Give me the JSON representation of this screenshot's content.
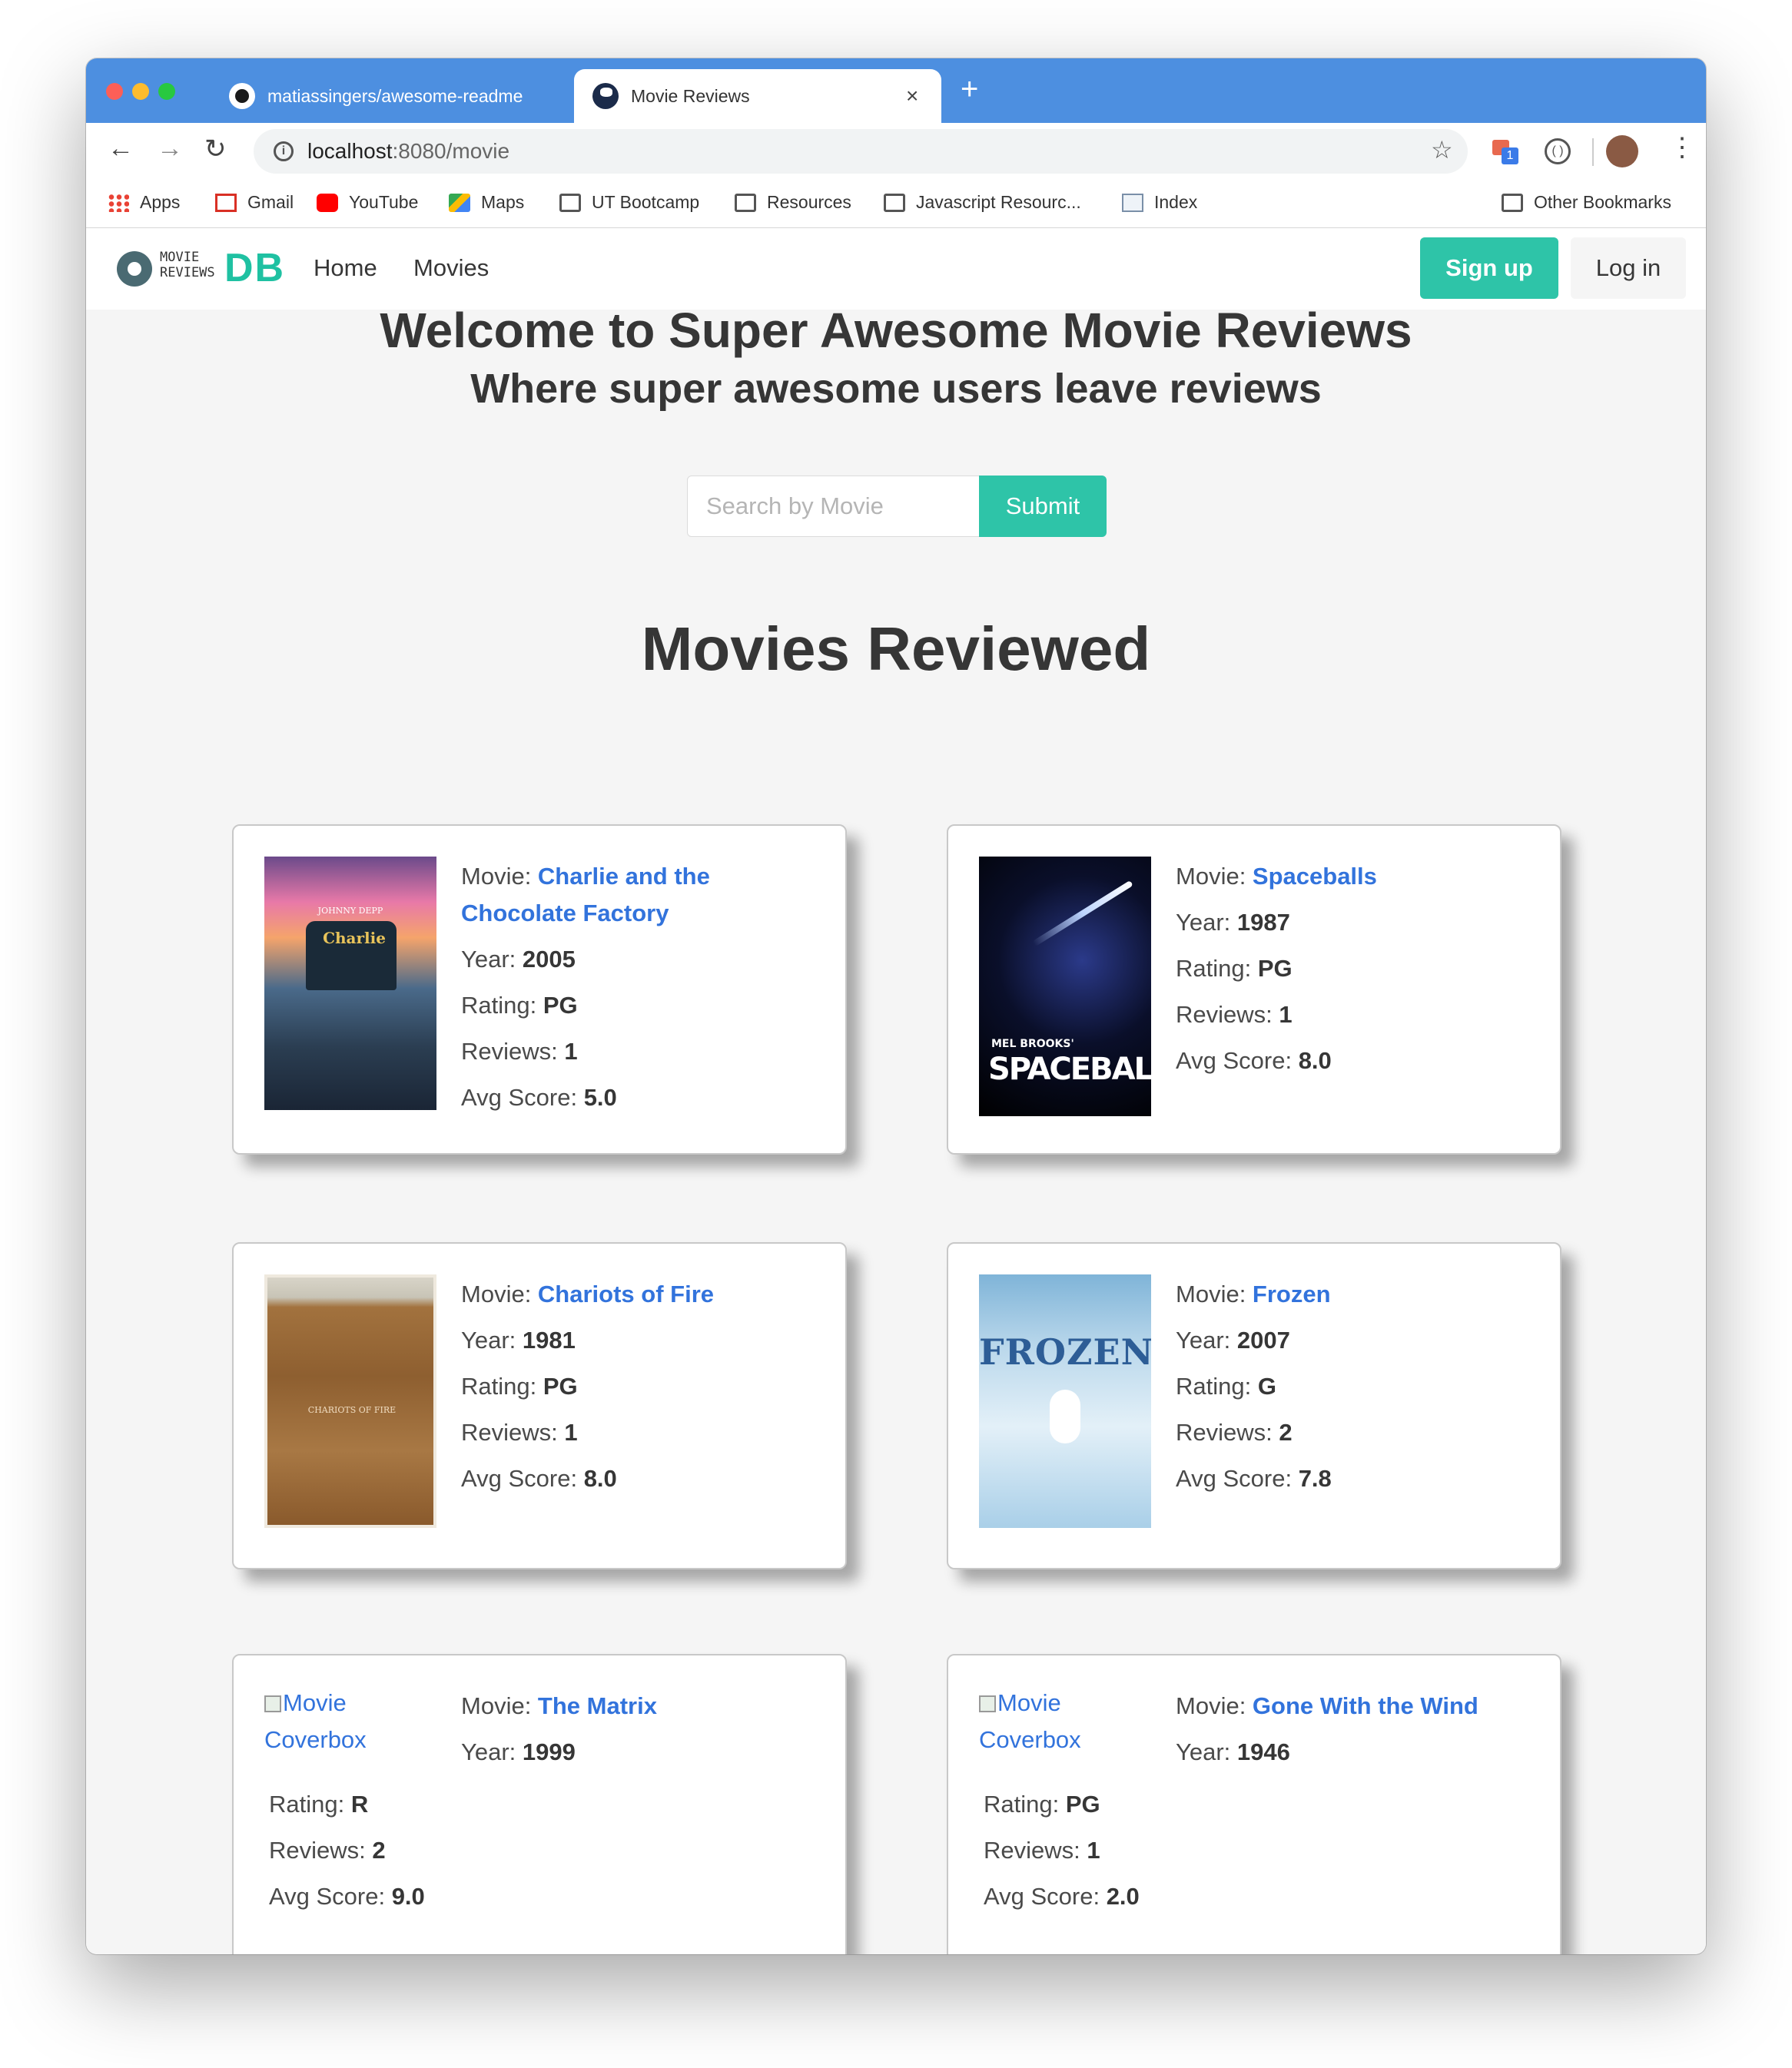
{
  "browser": {
    "tabs": [
      {
        "title": "matiassingers/awesome-readme",
        "icon": "github-icon"
      },
      {
        "title": "Movie Reviews",
        "icon": "globe-icon"
      }
    ],
    "close_glyph": "×",
    "new_tab_glyph": "+",
    "url_host": "localhost",
    "url_rest": ":8080/movie",
    "extension_badge": "1",
    "bookmarks": [
      "Apps",
      "Gmail",
      "YouTube",
      "Maps",
      "UT Bootcamp",
      "Resources",
      "Javascript Resourc...",
      "Index"
    ],
    "other_bookmarks": "Other Bookmarks"
  },
  "site": {
    "logo_small": "MOVIE REVIEWS",
    "logo_big": "DB",
    "nav": [
      "Home",
      "Movies"
    ],
    "signup": "Sign up",
    "login": "Log in",
    "accent": "#2ec4a8"
  },
  "hero": {
    "title": "Welcome to Super Awesome Movie Reviews",
    "subtitle": "Where super awesome users leave reviews"
  },
  "search": {
    "placeholder": "Search by Movie",
    "submit": "Submit"
  },
  "section_title": "Movies Reviewed",
  "labels": {
    "movie": "Movie: ",
    "year": "Year: ",
    "rating": "Rating: ",
    "reviews": "Reviews: ",
    "avg": "Avg Score: ",
    "broken_alt_1": "Movie",
    "broken_alt_2": "Coverbox"
  },
  "movies": [
    {
      "title": "Charlie and the Chocolate Factory",
      "year": "2005",
      "rating": "PG",
      "reviews": "1",
      "avg": "5.0",
      "poster_text": "Charlie",
      "poster_top": "JOHNNY DEPP"
    },
    {
      "title": "Spaceballs",
      "year": "1987",
      "rating": "PG",
      "reviews": "1",
      "avg": "8.0",
      "poster_text": "SPACEBALLS",
      "poster_top": "MEL BROOKS'"
    },
    {
      "title": "Chariots of Fire",
      "year": "1981",
      "rating": "PG",
      "reviews": "1",
      "avg": "8.0",
      "poster_text": "CHARIOTS OF FIRE"
    },
    {
      "title": "Frozen",
      "year": "2007",
      "rating": "G",
      "reviews": "2",
      "avg": "7.8",
      "poster_text": "FROZEN"
    },
    {
      "title": "The Matrix",
      "year": "1999",
      "rating": "R",
      "reviews": "2",
      "avg": "9.0"
    },
    {
      "title": "Gone With the Wind",
      "year": "1946",
      "rating": "PG",
      "reviews": "1",
      "avg": "2.0"
    }
  ]
}
